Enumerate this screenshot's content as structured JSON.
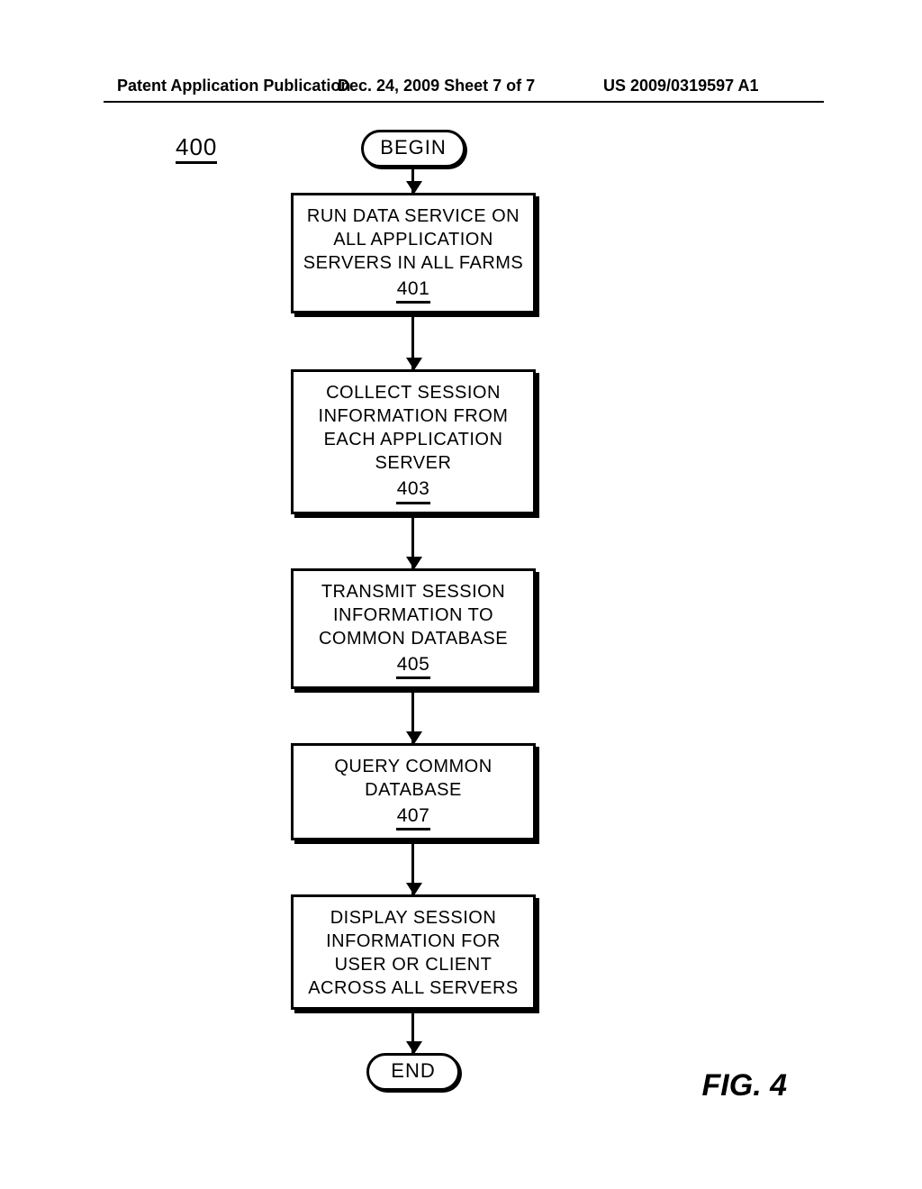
{
  "header": {
    "left": "Patent Application Publication",
    "mid": "Dec. 24, 2009  Sheet 7 of 7",
    "right": "US 2009/0319597 A1"
  },
  "figure_ref": "400",
  "terminators": {
    "begin": "BEGIN",
    "end": "END"
  },
  "steps": [
    {
      "text": "RUN DATA SERVICE ON ALL APPLICATION SERVERS IN ALL FARMS",
      "ref": "401"
    },
    {
      "text": "COLLECT SESSION INFORMATION FROM EACH APPLICATION SERVER",
      "ref": "403"
    },
    {
      "text": "TRANSMIT SESSION INFORMATION TO COMMON DATABASE",
      "ref": "405"
    },
    {
      "text": "QUERY COMMON DATABASE",
      "ref": "407"
    },
    {
      "text": "DISPLAY SESSION INFORMATION FOR USER OR CLIENT ACROSS ALL SERVERS",
      "ref": ""
    }
  ],
  "figure_label": "FIG. 4"
}
